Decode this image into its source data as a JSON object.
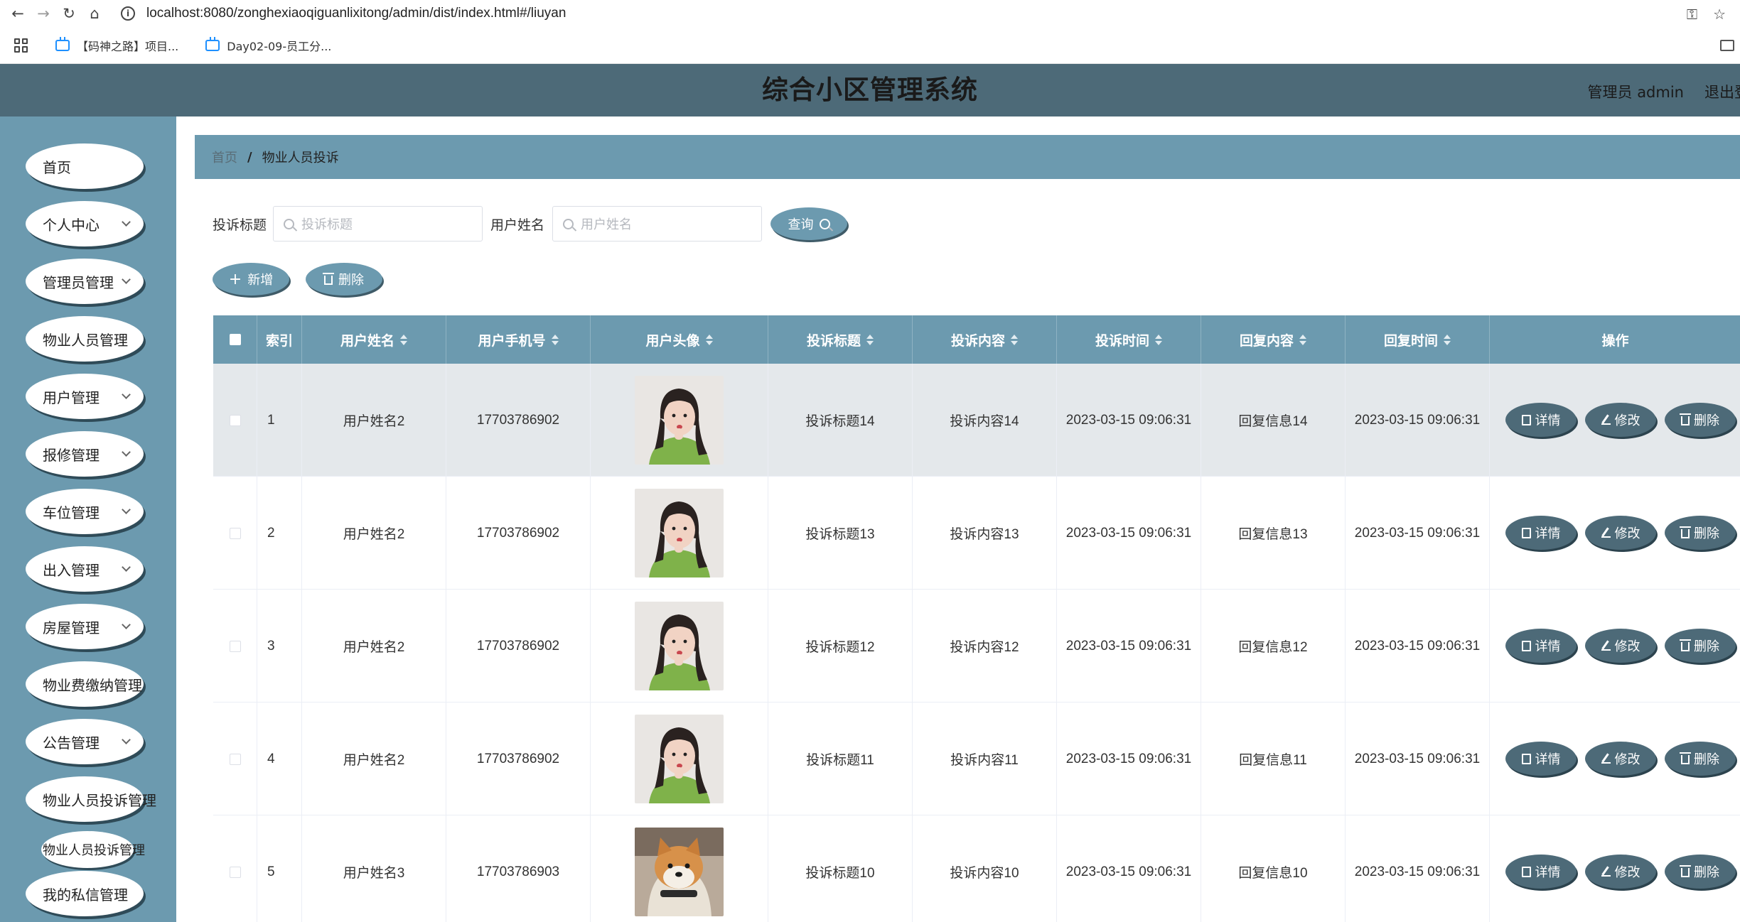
{
  "browser": {
    "url": "localhost:8080/zonghexiaoqiguanlixitong/admin/dist/index.html#/liuyan",
    "bookmarks": [
      "【码神之路】项目...",
      "Day02-09-员工分..."
    ]
  },
  "header": {
    "title": "综合小区管理系统",
    "user": "管理员 admin",
    "logout": "退出登录"
  },
  "sidebar": {
    "items": [
      {
        "label": "首页",
        "expandable": false
      },
      {
        "label": "个人中心",
        "expandable": true
      },
      {
        "label": "管理员管理",
        "expandable": true
      },
      {
        "label": "物业人员管理",
        "expandable": false
      },
      {
        "label": "用户管理",
        "expandable": true
      },
      {
        "label": "报修管理",
        "expandable": true
      },
      {
        "label": "车位管理",
        "expandable": true
      },
      {
        "label": "出入管理",
        "expandable": true
      },
      {
        "label": "房屋管理",
        "expandable": true
      },
      {
        "label": "物业费缴纳管理",
        "expandable": false
      },
      {
        "label": "公告管理",
        "expandable": true
      },
      {
        "label": "物业人员投诉管理",
        "expandable": false
      },
      {
        "label": "我的私信管理",
        "expandable": false
      }
    ],
    "sub_item": "物业人员投诉管理"
  },
  "breadcrumb": {
    "home": "首页",
    "separator": "/",
    "current": "物业人员投诉"
  },
  "search": {
    "title_label": "投诉标题",
    "title_placeholder": "投诉标题",
    "name_label": "用户姓名",
    "name_placeholder": "用户姓名",
    "query_button": "查询"
  },
  "actions": {
    "add_button": "新增",
    "delete_button": "删除"
  },
  "table": {
    "headers": [
      "索引",
      "用户姓名",
      "用户手机号",
      "用户头像",
      "投诉标题",
      "投诉内容",
      "投诉时间",
      "回复内容",
      "回复时间",
      "操作"
    ],
    "rows": [
      {
        "index": "1",
        "name": "用户姓名2",
        "phone": "17703786902",
        "avatar": "girl",
        "title": "投诉标题14",
        "content": "投诉内容14",
        "time": "2023-03-15 09:06:31",
        "reply": "回复信息14",
        "reply_time": "2023-03-15 09:06:31"
      },
      {
        "index": "2",
        "name": "用户姓名2",
        "phone": "17703786902",
        "avatar": "girl",
        "title": "投诉标题13",
        "content": "投诉内容13",
        "time": "2023-03-15 09:06:31",
        "reply": "回复信息13",
        "reply_time": "2023-03-15 09:06:31"
      },
      {
        "index": "3",
        "name": "用户姓名2",
        "phone": "17703786902",
        "avatar": "girl",
        "title": "投诉标题12",
        "content": "投诉内容12",
        "time": "2023-03-15 09:06:31",
        "reply": "回复信息12",
        "reply_time": "2023-03-15 09:06:31"
      },
      {
        "index": "4",
        "name": "用户姓名2",
        "phone": "17703786902",
        "avatar": "girl",
        "title": "投诉标题11",
        "content": "投诉内容11",
        "time": "2023-03-15 09:06:31",
        "reply": "回复信息11",
        "reply_time": "2023-03-15 09:06:31"
      },
      {
        "index": "5",
        "name": "用户姓名3",
        "phone": "17703786903",
        "avatar": "dog",
        "title": "投诉标题10",
        "content": "投诉内容10",
        "time": "2023-03-15 09:06:31",
        "reply": "回复信息10",
        "reply_time": "2023-03-15 09:06:31"
      }
    ],
    "row_actions": {
      "detail": "详情",
      "edit": "修改",
      "delete": "删除"
    }
  },
  "colors": {
    "header_bg": "#4d6a78",
    "sidebar_bg": "#6c9aaf",
    "table_header_bg": "#6c9aaf",
    "action_button_bg": "#4d6a78"
  }
}
